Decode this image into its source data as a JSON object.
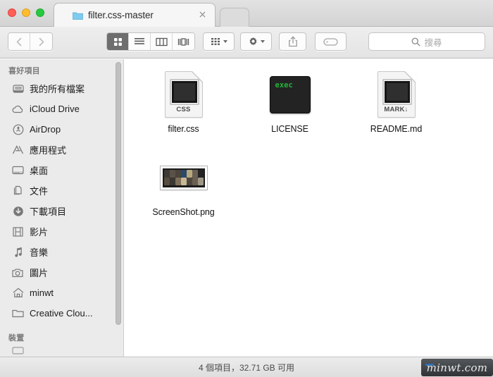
{
  "window": {
    "traffic_lights": [
      {
        "name": "close",
        "color": "#ff5f57"
      },
      {
        "name": "minimize",
        "color": "#febc2e"
      },
      {
        "name": "zoom",
        "color": "#28c840"
      }
    ]
  },
  "tabbar": {
    "active_tab": {
      "title": "filter.css-master",
      "icon": "folder-icon",
      "close_label": "×"
    },
    "inactive_tab": {
      "title": ""
    }
  },
  "toolbar": {
    "back_label": "‹",
    "forward_label": "›",
    "view_modes": [
      {
        "name": "icon-view",
        "active": true
      },
      {
        "name": "list-view",
        "active": false
      },
      {
        "name": "column-view",
        "active": false
      },
      {
        "name": "coverflow-view",
        "active": false
      }
    ],
    "arrange_label": "arrange-icon",
    "action_label": "gear-icon",
    "share_label": "share-icon",
    "tag_label": "tag-icon"
  },
  "search": {
    "placeholder": "搜尋",
    "value": "",
    "icon": "search-icon"
  },
  "sidebar": {
    "sections": [
      {
        "header": "喜好項目",
        "items": [
          {
            "label": "我的所有檔案",
            "icon": "all-my-files-icon"
          },
          {
            "label": "iCloud Drive",
            "icon": "cloud-icon"
          },
          {
            "label": "AirDrop",
            "icon": "airdrop-icon"
          },
          {
            "label": "應用程式",
            "icon": "applications-icon"
          },
          {
            "label": "桌面",
            "icon": "desktop-icon"
          },
          {
            "label": "文件",
            "icon": "documents-icon"
          },
          {
            "label": "下載項目",
            "icon": "downloads-icon"
          },
          {
            "label": "影片",
            "icon": "movies-icon"
          },
          {
            "label": "音樂",
            "icon": "music-icon"
          },
          {
            "label": "圖片",
            "icon": "pictures-icon"
          },
          {
            "label": "minwt",
            "icon": "home-icon"
          },
          {
            "label": "Creative Clou...",
            "icon": "folder-icon"
          }
        ]
      },
      {
        "header": "裝置",
        "items": []
      }
    ]
  },
  "content": {
    "files": [
      {
        "name": "filter.css",
        "icon_type": "document",
        "badge": "CSS"
      },
      {
        "name": "LICENSE",
        "icon_type": "executable",
        "badge": "exec"
      },
      {
        "name": "README.md",
        "icon_type": "document",
        "badge": "MARK↓"
      },
      {
        "name": "ScreenShot.png",
        "icon_type": "image-thumbnail",
        "badge": ""
      }
    ]
  },
  "statusbar": {
    "text": "4 個項目，32.71 GB 可用",
    "watermark": "minwt.com"
  },
  "colors": {
    "toolbar_bg": "#e8e8e8",
    "sidebar_bg": "#ebebeb",
    "content_bg": "#ffffff",
    "active_view_btn": "#6e6e6e",
    "exec_green": "#25b33c"
  }
}
